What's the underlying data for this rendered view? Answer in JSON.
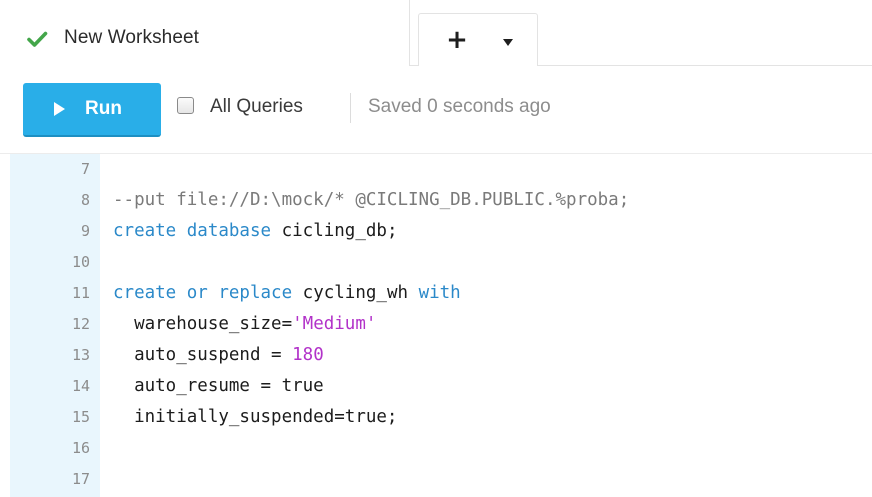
{
  "tab": {
    "title": "New Worksheet",
    "status_icon": "checkmark-icon",
    "status_color": "#43a64a",
    "add_label": "+",
    "menu_icon": "caret-down-icon"
  },
  "toolbar": {
    "run_label": "Run",
    "run_icon": "play-icon",
    "run_color": "#29aee8",
    "all_queries_label": "All Queries",
    "all_queries_checked": false,
    "saved_status": "Saved 0 seconds ago"
  },
  "editor": {
    "lines": [
      {
        "num": "7",
        "tokens": []
      },
      {
        "num": "8",
        "tokens": [
          {
            "t": "--put file://D:\\mock/* @CICLING_DB.PUBLIC.%proba;",
            "c": "cmt"
          }
        ]
      },
      {
        "num": "9",
        "tokens": [
          {
            "t": "create database",
            "c": "kw"
          },
          {
            "t": " cicling_db;",
            "c": ""
          }
        ]
      },
      {
        "num": "10",
        "tokens": []
      },
      {
        "num": "11",
        "tokens": [
          {
            "t": "create or replace",
            "c": "kw"
          },
          {
            "t": " cycling_wh ",
            "c": ""
          },
          {
            "t": "with",
            "c": "kw"
          }
        ]
      },
      {
        "num": "12",
        "tokens": [
          {
            "t": "  warehouse_size=",
            "c": ""
          },
          {
            "t": "'Medium'",
            "c": "str"
          }
        ]
      },
      {
        "num": "13",
        "tokens": [
          {
            "t": "  auto_suspend = ",
            "c": ""
          },
          {
            "t": "180",
            "c": "num"
          }
        ]
      },
      {
        "num": "14",
        "tokens": [
          {
            "t": "  auto_resume = true",
            "c": ""
          }
        ]
      },
      {
        "num": "15",
        "tokens": [
          {
            "t": "  initially_suspended=true;",
            "c": ""
          }
        ]
      },
      {
        "num": "16",
        "tokens": []
      },
      {
        "num": "17",
        "tokens": []
      }
    ],
    "colors": {
      "keyword": "#2b89c9",
      "string": "#b232c9",
      "comment": "#7a7a7a",
      "gutter": "#e9f6fd"
    }
  }
}
